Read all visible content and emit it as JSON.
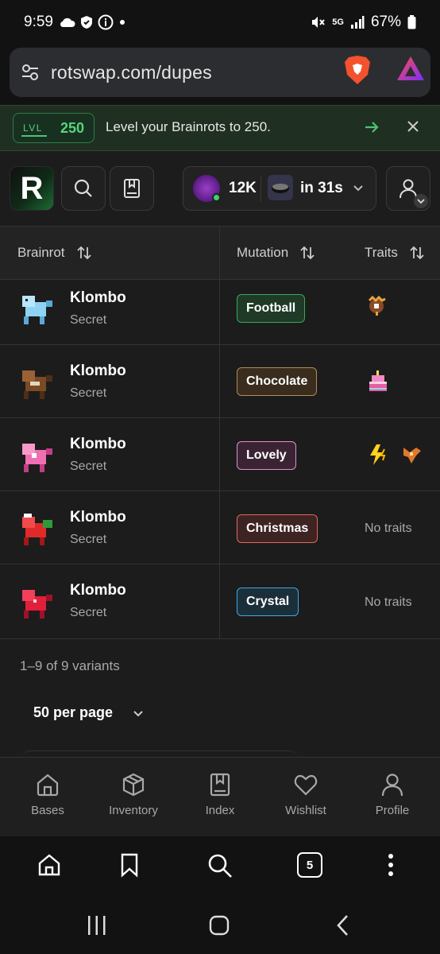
{
  "status_bar": {
    "time": "9:59",
    "network": "5G",
    "battery": "67%"
  },
  "browser": {
    "url": "rotswap.com/dupes",
    "tab_count": "5"
  },
  "banner": {
    "lvl_label": "LVL",
    "lvl_value": "250",
    "message": "Level your Brainrots to 250."
  },
  "header": {
    "balance": "12K",
    "timer": "in 31s"
  },
  "table": {
    "headers": {
      "brainrot": "Brainrot",
      "mutation": "Mutation",
      "traits": "Traits"
    },
    "rows": [
      {
        "name": "Klombo",
        "rarity": "Secret",
        "mutation": "Football",
        "mutation_bg": "#1f3a26",
        "mutation_border": "#3aa85b",
        "traits": [
          "turkey-trait-icon"
        ],
        "sprite_color": "#8fd3f4"
      },
      {
        "name": "Klombo",
        "rarity": "Secret",
        "mutation": "Chocolate",
        "mutation_bg": "#3a2d1e",
        "mutation_border": "#b08a5a",
        "traits": [
          "cake-trait-icon"
        ],
        "sprite_color": "#7a4a25"
      },
      {
        "name": "Klombo",
        "rarity": "Secret",
        "mutation": "Lovely",
        "mutation_bg": "#3a2433",
        "mutation_border": "#e290c8",
        "traits": [
          "lightning-trait-icon",
          "fire-bat-trait-icon"
        ],
        "sprite_color": "#f06fb3"
      },
      {
        "name": "Klombo",
        "rarity": "Secret",
        "mutation": "Christmas",
        "mutation_bg": "#3d2321",
        "mutation_border": "#e0695c",
        "traits": [],
        "no_traits": "No traits",
        "sprite_color": "#e02a2a"
      },
      {
        "name": "Klombo",
        "rarity": "Secret",
        "mutation": "Crystal",
        "mutation_bg": "#1b2f3b",
        "mutation_border": "#3ea8df",
        "traits": [],
        "no_traits": "No traits",
        "sprite_color": "#e01f38"
      }
    ]
  },
  "pagination": {
    "summary": "1–9 of 9 variants",
    "per_page": "50 per page"
  },
  "app_nav": {
    "bases": "Bases",
    "inventory": "Inventory",
    "index": "Index",
    "wishlist": "Wishlist",
    "profile": "Profile"
  },
  "colors": {
    "accent_green": "#4ec274",
    "background": "#1c1c1c"
  }
}
